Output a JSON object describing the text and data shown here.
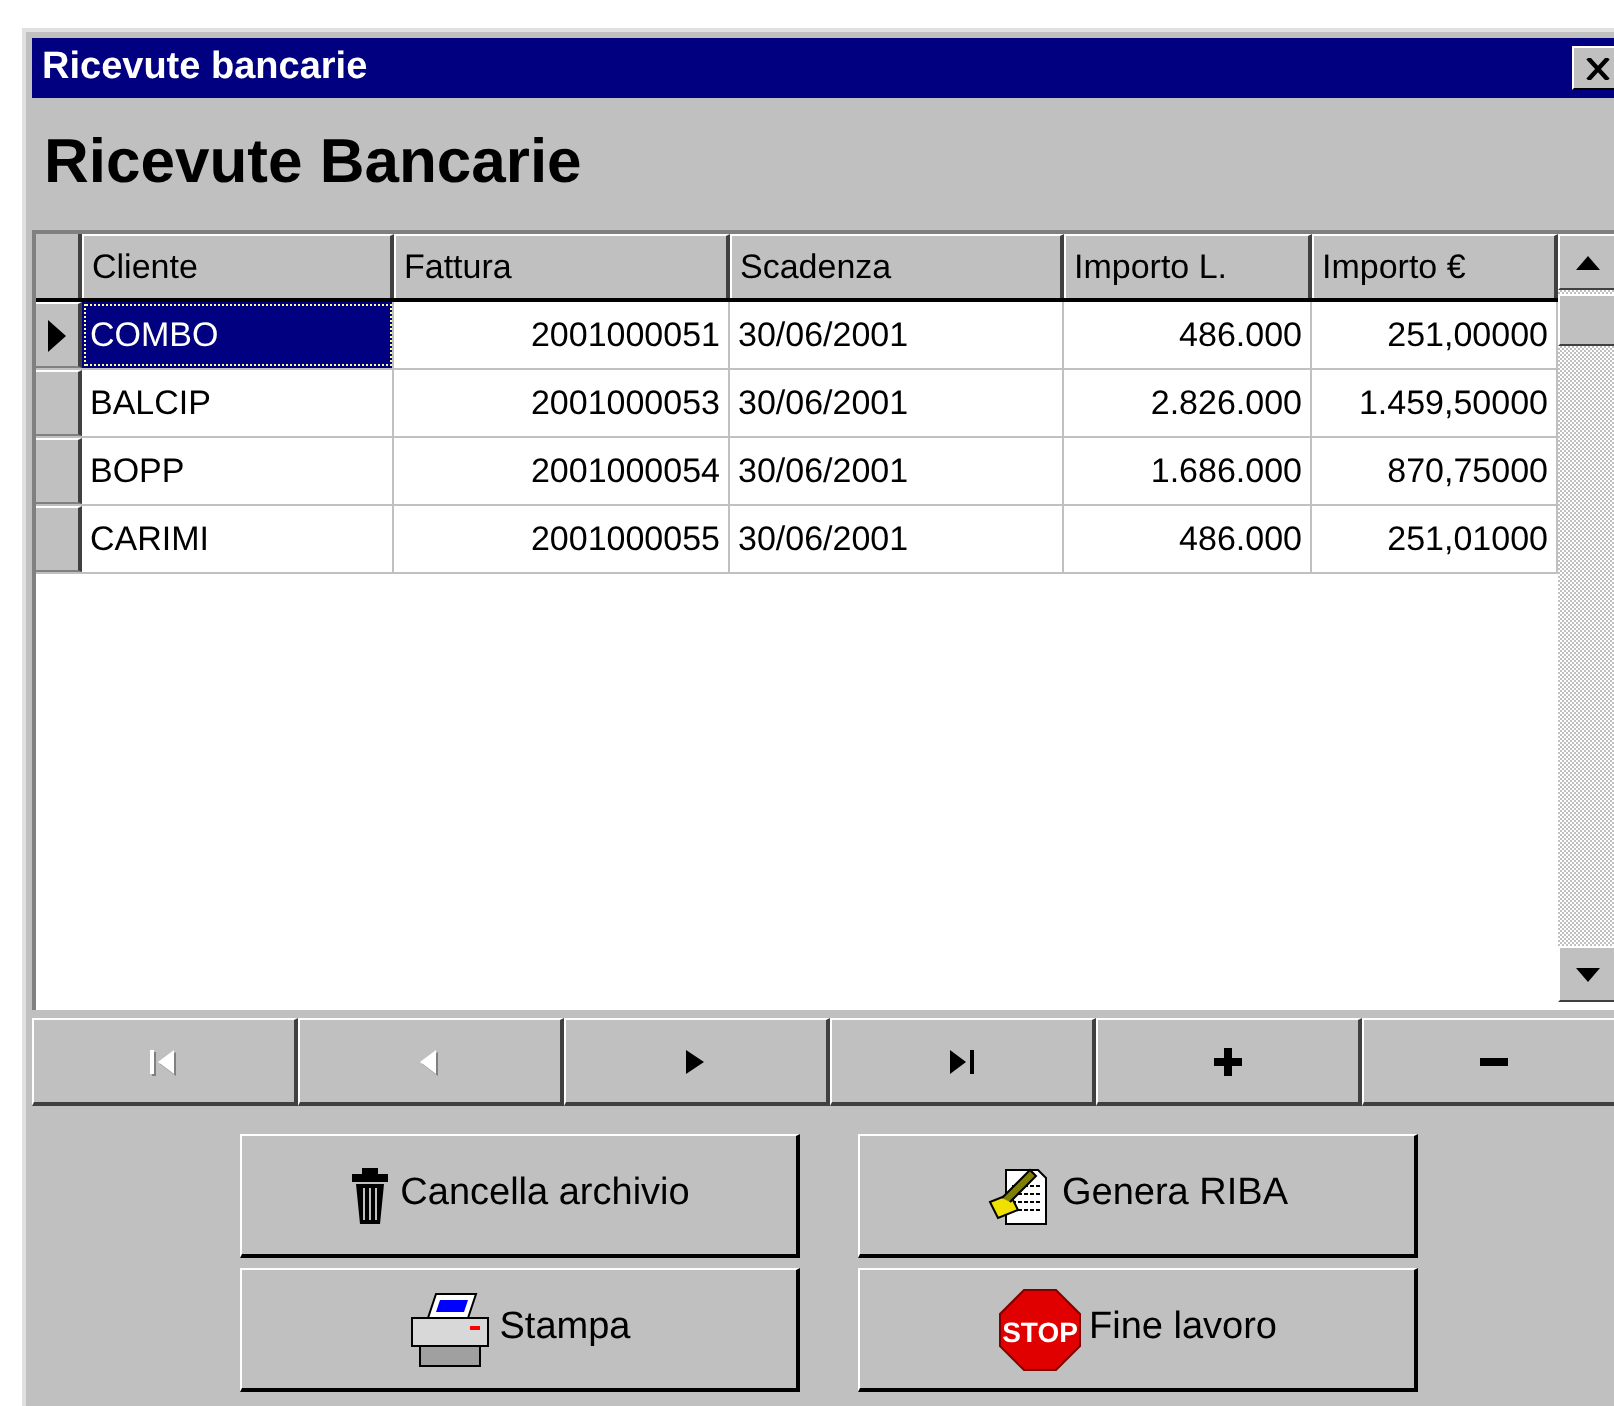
{
  "window": {
    "title": "Ricevute bancarie"
  },
  "heading": "Ricevute Bancarie",
  "table": {
    "columns": [
      "Cliente",
      "Fattura",
      "Scadenza",
      "Importo L.",
      "Importo €"
    ],
    "rows": [
      {
        "selected": true,
        "cells": [
          "COMBO",
          "2001000051",
          "30/06/2001",
          "486.000",
          "251,00000"
        ]
      },
      {
        "selected": false,
        "cells": [
          "BALCIP",
          "2001000053",
          "30/06/2001",
          "2.826.000",
          "1.459,50000"
        ]
      },
      {
        "selected": false,
        "cells": [
          "BOPP",
          "2001000054",
          "30/06/2001",
          "1.686.000",
          "870,75000"
        ]
      },
      {
        "selected": false,
        "cells": [
          "CARIMI",
          "2001000055",
          "30/06/2001",
          "486.000",
          "251,01000"
        ]
      }
    ]
  },
  "navigator": [
    {
      "kind": "first",
      "disabled": true
    },
    {
      "kind": "prev",
      "disabled": true
    },
    {
      "kind": "next",
      "disabled": false
    },
    {
      "kind": "last",
      "disabled": false
    },
    {
      "kind": "add",
      "disabled": false
    },
    {
      "kind": "remove",
      "disabled": false
    }
  ],
  "buttons": [
    {
      "label": "Cancella archivio"
    },
    {
      "label": "Genera RIBA"
    },
    {
      "label": "Stampa"
    },
    {
      "label": "Fine lavoro",
      "icon_text": "STOP"
    }
  ]
}
